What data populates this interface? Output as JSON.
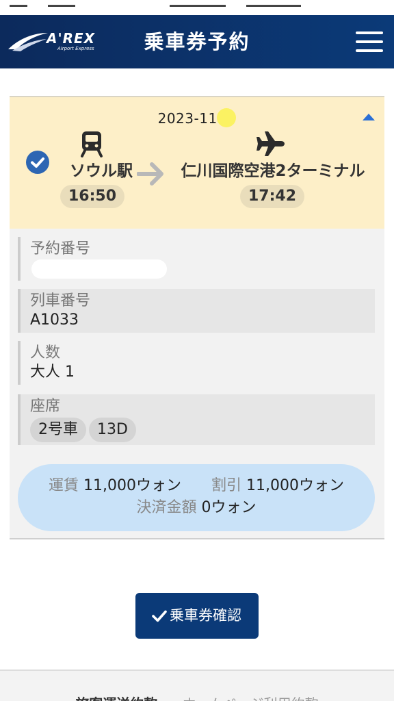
{
  "header": {
    "logo_text": "A'REX",
    "logo_sub": "Airport Express",
    "title": "乗車券予約"
  },
  "route": {
    "date": "2023-11-",
    "from": {
      "name": "ソウル駅",
      "time": "16:50"
    },
    "to": {
      "name": "仁川国際空港2ターミナル",
      "time": "17:42"
    }
  },
  "details": {
    "reservation_number": {
      "label": "予約番号",
      "value": ""
    },
    "train_number": {
      "label": "列車番号",
      "value": "A1033"
    },
    "passengers": {
      "label": "人数",
      "value": "大人 1"
    },
    "seat": {
      "label": "座席",
      "car": "2号車",
      "seat_no": "13D"
    }
  },
  "fare": {
    "fare_label": "運賃",
    "fare_value": "11,000ウォン",
    "discount_label": "割引",
    "discount_value": "11,000ウォン",
    "total_label": "決済金額",
    "total_value": "0ウォン"
  },
  "actions": {
    "confirm_label": "乗車券確認"
  },
  "footer": {
    "link1": "旅客運送約款",
    "link2": "ホームページ利用約款"
  },
  "colors": {
    "header": "#0b3a78",
    "route_bg": "#fdefc8",
    "fare_bg": "#c9e2f8",
    "accent": "#2a6fd6"
  }
}
